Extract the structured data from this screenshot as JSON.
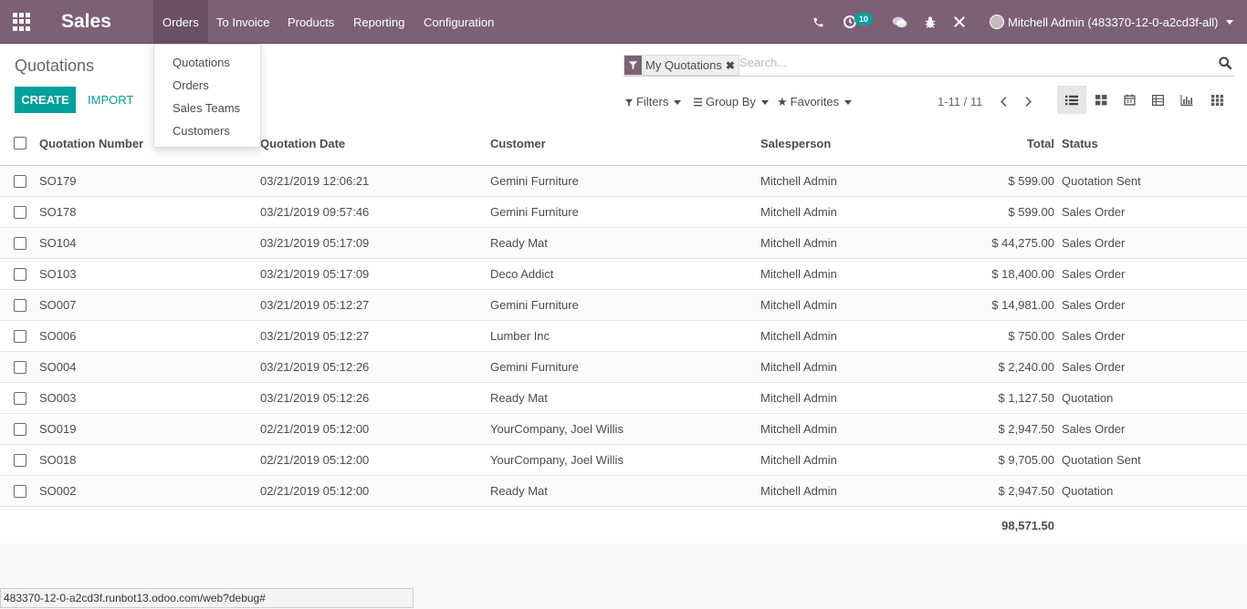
{
  "navbar": {
    "brand": "Sales",
    "menu": [
      "Orders",
      "To Invoice",
      "Products",
      "Reporting",
      "Configuration"
    ],
    "activity_badge": "10",
    "user": "Mitchell Admin (483370-12-0-a2cd3f-all)",
    "icons": [
      "apps-grid-icon",
      "phone-icon",
      "activity-clock-icon",
      "chat-icon",
      "debug-bug-icon",
      "tools-icon"
    ]
  },
  "orders_menu": [
    "Quotations",
    "Orders",
    "Sales Teams",
    "Customers"
  ],
  "control": {
    "title": "Quotations",
    "create": "CREATE",
    "import": "IMPORT",
    "facet": "My Quotations",
    "search_placeholder": "Search...",
    "filters": "Filters",
    "group_by": "Group By",
    "favorites": "Favorites",
    "pager": "1-11 / 11",
    "views": [
      "list-view-icon",
      "kanban-view-icon",
      "calendar-view-icon",
      "pivot-view-icon",
      "graph-view-icon",
      "activity-view-icon"
    ]
  },
  "table": {
    "headers": {
      "number": "Quotation Number",
      "date": "Quotation Date",
      "customer": "Customer",
      "salesperson": "Salesperson",
      "total": "Total",
      "status": "Status"
    },
    "rows": [
      {
        "number": "SO179",
        "date": "03/21/2019 12:06:21",
        "customer": "Gemini Furniture",
        "salesperson": "Mitchell Admin",
        "total": "$ 599.00",
        "status": "Quotation Sent"
      },
      {
        "number": "SO178",
        "date": "03/21/2019 09:57:46",
        "customer": "Gemini Furniture",
        "salesperson": "Mitchell Admin",
        "total": "$ 599.00",
        "status": "Sales Order"
      },
      {
        "number": "SO104",
        "date": "03/21/2019 05:17:09",
        "customer": "Ready Mat",
        "salesperson": "Mitchell Admin",
        "total": "$ 44,275.00",
        "status": "Sales Order"
      },
      {
        "number": "SO103",
        "date": "03/21/2019 05:17:09",
        "customer": "Deco Addict",
        "salesperson": "Mitchell Admin",
        "total": "$ 18,400.00",
        "status": "Sales Order"
      },
      {
        "number": "SO007",
        "date": "03/21/2019 05:12:27",
        "customer": "Gemini Furniture",
        "salesperson": "Mitchell Admin",
        "total": "$ 14,981.00",
        "status": "Sales Order"
      },
      {
        "number": "SO006",
        "date": "03/21/2019 05:12:27",
        "customer": "Lumber Inc",
        "salesperson": "Mitchell Admin",
        "total": "$ 750.00",
        "status": "Sales Order"
      },
      {
        "number": "SO004",
        "date": "03/21/2019 05:12:26",
        "customer": "Gemini Furniture",
        "salesperson": "Mitchell Admin",
        "total": "$ 2,240.00",
        "status": "Sales Order"
      },
      {
        "number": "SO003",
        "date": "03/21/2019 05:12:26",
        "customer": "Ready Mat",
        "salesperson": "Mitchell Admin",
        "total": "$ 1,127.50",
        "status": "Quotation"
      },
      {
        "number": "SO019",
        "date": "02/21/2019 05:12:00",
        "customer": "YourCompany, Joel Willis",
        "salesperson": "Mitchell Admin",
        "total": "$ 2,947.50",
        "status": "Sales Order"
      },
      {
        "number": "SO018",
        "date": "02/21/2019 05:12:00",
        "customer": "YourCompany, Joel Willis",
        "salesperson": "Mitchell Admin",
        "total": "$ 9,705.00",
        "status": "Quotation Sent"
      },
      {
        "number": "SO002",
        "date": "02/21/2019 05:12:00",
        "customer": "Ready Mat",
        "salesperson": "Mitchell Admin",
        "total": "$ 2,947.50",
        "status": "Quotation"
      }
    ],
    "sum_total": "98,571.50"
  },
  "status_url": "483370-12-0-a2cd3f.runbot13.odoo.com/web?debug#",
  "colors": {
    "brand": "#7c6176",
    "accent": "#00a09d"
  }
}
